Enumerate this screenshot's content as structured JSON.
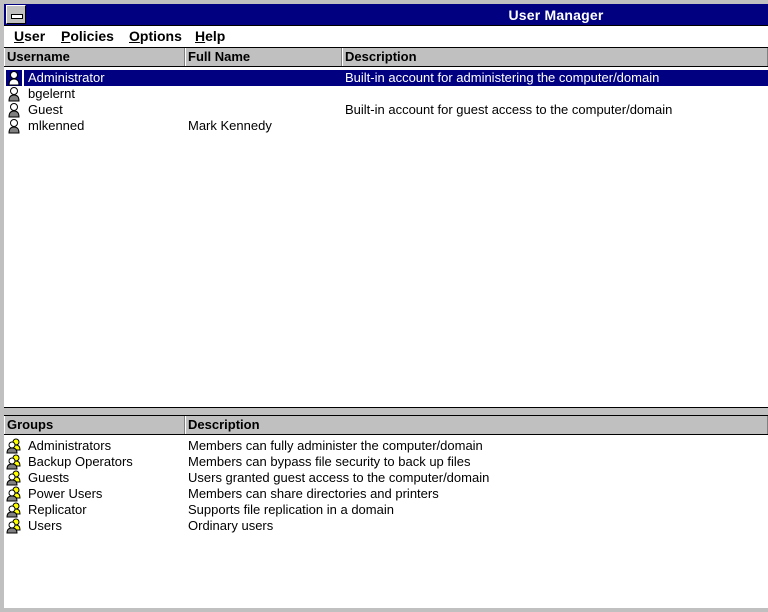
{
  "window": {
    "title": "User Manager"
  },
  "menu": [
    {
      "label": "User",
      "underline": "U"
    },
    {
      "label": "Policies",
      "underline": "P"
    },
    {
      "label": "Options",
      "underline": "O"
    },
    {
      "label": "Help",
      "underline": "H"
    }
  ],
  "users": {
    "columns": [
      "Username",
      "Full Name",
      "Description"
    ],
    "rows": [
      {
        "icon": "user-icon",
        "username": "Administrator",
        "full_name": "",
        "description": "Built-in account for administering the computer/domain",
        "selected": true
      },
      {
        "icon": "user-icon",
        "username": "bgelernt",
        "full_name": "",
        "description": ""
      },
      {
        "icon": "user-icon",
        "username": "Guest",
        "full_name": "",
        "description": "Built-in account for guest access to the computer/domain"
      },
      {
        "icon": "user-icon",
        "username": "mlkenned",
        "full_name": "Mark Kennedy",
        "description": ""
      }
    ]
  },
  "groups": {
    "columns": [
      "Groups",
      "Description"
    ],
    "rows": [
      {
        "icon": "group-icon",
        "name": "Administrators",
        "description": "Members can fully administer the computer/domain"
      },
      {
        "icon": "group-icon",
        "name": "Backup Operators",
        "description": "Members can bypass file security to back up files"
      },
      {
        "icon": "group-icon",
        "name": "Guests",
        "description": "Users granted guest access to the computer/domain"
      },
      {
        "icon": "group-icon",
        "name": "Power Users",
        "description": "Members can share directories and printers"
      },
      {
        "icon": "group-icon",
        "name": "Replicator",
        "description": "Supports file replication in a domain"
      },
      {
        "icon": "group-icon",
        "name": "Users",
        "description": "Ordinary users"
      }
    ]
  },
  "colors": {
    "titlebar": "#000080",
    "selection": "#000080",
    "desktop": "#008080",
    "face": "#c0c0c0"
  }
}
